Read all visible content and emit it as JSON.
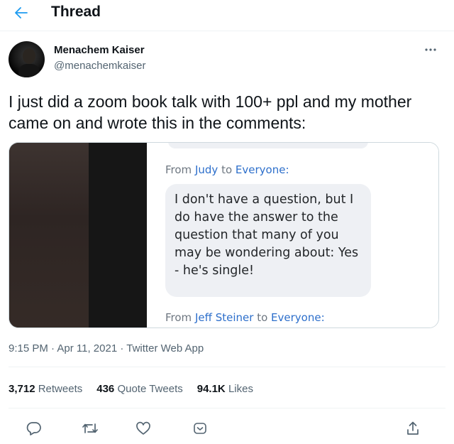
{
  "header": {
    "title": "Thread",
    "back_icon": "arrow-left-icon",
    "accent_color": "#1d9bf0"
  },
  "tweet": {
    "author": {
      "name": "Menachem Kaiser",
      "handle": "@menachemkaiser"
    },
    "text": "I just did a zoom book talk with 100+ ppl and my mother came on and wrote this in the comments:",
    "media": {
      "chat_from_1": {
        "prefix": "From",
        "sender": "Judy",
        "to": "to",
        "recipient": "Everyone:"
      },
      "message": "I don't have a question, but I do have the answer to the question that many of you may be wondering about: Yes - he's single!",
      "chat_from_2": {
        "prefix": "From",
        "sender": "Jeff Steiner",
        "to": "to",
        "recipient": "Everyone:"
      }
    },
    "meta": {
      "time": "9:15 PM",
      "sep": "·",
      "date": "Apr 11, 2021",
      "source": "Twitter Web App"
    },
    "stats": {
      "retweets_count": "3,712",
      "retweets_label": "Retweets",
      "quotes_count": "436",
      "quotes_label": "Quote Tweets",
      "likes_count": "94.1K",
      "likes_label": "Likes"
    },
    "actions": [
      "reply-icon",
      "retweet-icon",
      "like-icon",
      "react-icon",
      "share-icon"
    ]
  }
}
